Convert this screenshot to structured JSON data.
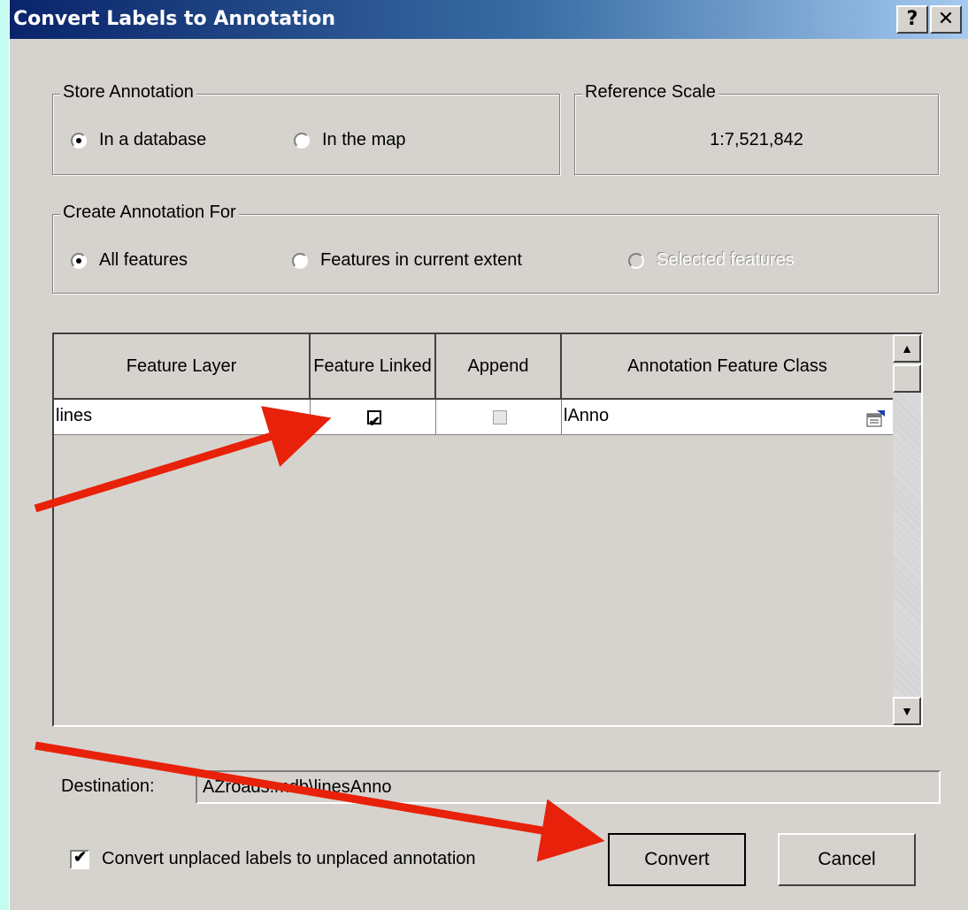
{
  "window": {
    "title": "Convert Labels to Annotation",
    "help_label": "?",
    "close_label": "✕"
  },
  "store_annotation": {
    "legend": "Store Annotation",
    "options": [
      {
        "label": "In a database",
        "selected": true
      },
      {
        "label": "In the map",
        "selected": false
      }
    ]
  },
  "reference_scale": {
    "legend": "Reference Scale",
    "value": "1:7,521,842"
  },
  "create_for": {
    "legend": "Create Annotation For",
    "options": [
      {
        "label": "All features",
        "selected": true,
        "enabled": true
      },
      {
        "label": "Features in current extent",
        "selected": false,
        "enabled": true
      },
      {
        "label": "Selected features",
        "selected": false,
        "enabled": false
      }
    ]
  },
  "grid": {
    "columns": [
      "Feature Layer",
      "Feature Linked",
      "Append",
      "Annotation Feature Class"
    ],
    "rows": [
      {
        "feature_layer": "lines",
        "feature_linked": true,
        "append": false,
        "annotation_class": "lAnno"
      }
    ]
  },
  "destination": {
    "label": "Destination:",
    "value": "AZroads.mdb\\linesAnno"
  },
  "convert_unplaced": {
    "label": "Convert unplaced labels to unplaced annotation",
    "checked": true
  },
  "buttons": {
    "convert": "Convert",
    "cancel": "Cancel"
  },
  "colors": {
    "background": "#c6fbf1",
    "dialog_face": "#d6d3ce",
    "titlebar_start": "#0a246a",
    "titlebar_end": "#a6caf0",
    "arrow": "#e8210a"
  }
}
